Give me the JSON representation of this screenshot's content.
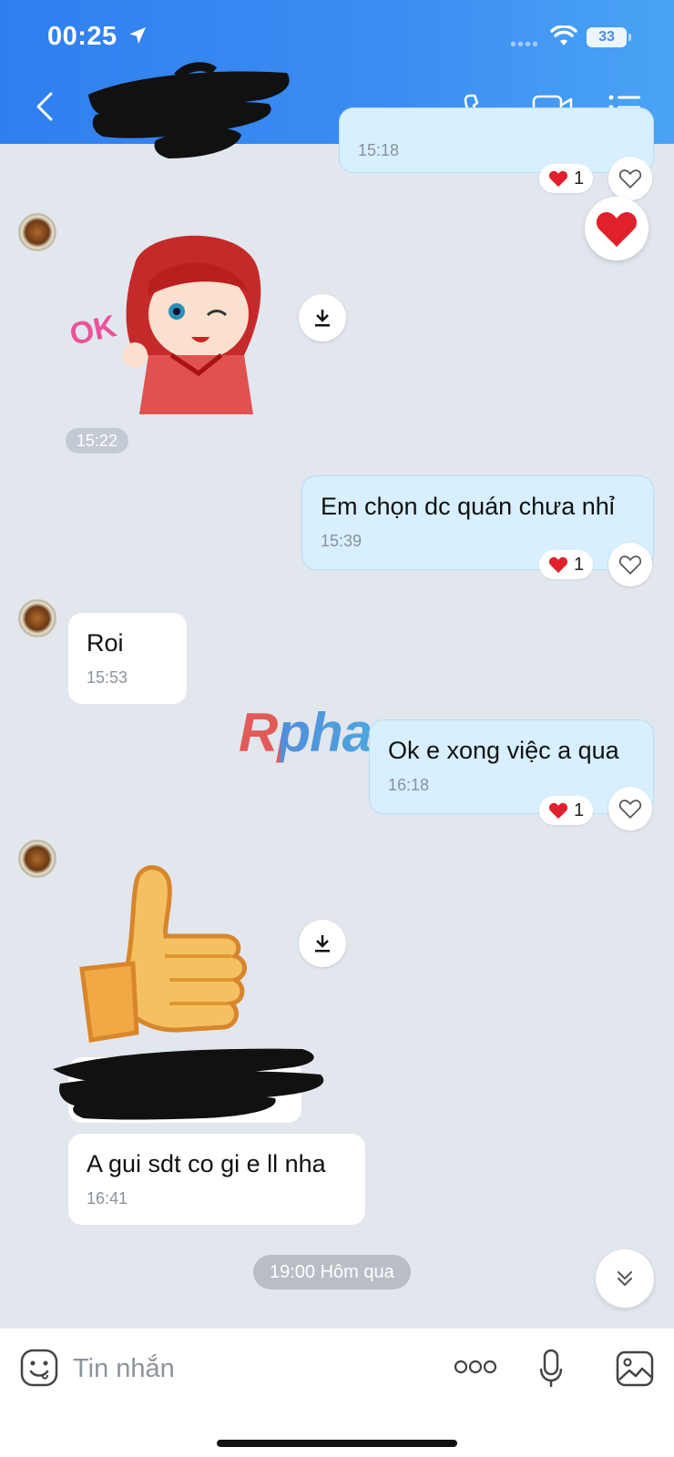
{
  "status_bar": {
    "time": "00:25",
    "battery": "33",
    "signal": "••••"
  },
  "header": {
    "contact_name": ""
  },
  "messages": [
    {
      "id": "m0",
      "direction": "out",
      "text": "",
      "time": "15:18",
      "reaction_count": "1"
    },
    {
      "id": "m1",
      "direction": "in",
      "type": "sticker",
      "sticker_name": "red-hood-girl-ok",
      "sticker_text": "OK",
      "time": "15:22"
    },
    {
      "id": "m2",
      "direction": "out",
      "text": "Em chọn dc quán chưa nhỉ",
      "time": "15:39",
      "reaction_count": "1"
    },
    {
      "id": "m3",
      "direction": "in",
      "text": "Roi",
      "time": "15:53"
    },
    {
      "id": "m4",
      "direction": "out",
      "text": "Ok e xong việc a qua",
      "time": "16:18",
      "reaction_count": "1"
    },
    {
      "id": "m5",
      "direction": "in",
      "type": "sticker",
      "sticker_name": "thumbs-up"
    },
    {
      "id": "m6",
      "direction": "in",
      "text": "A gui sdt co gi e ll nha",
      "time": "16:41"
    }
  ],
  "date_separator": "19:00 Hôm qua",
  "watermark": "Rphang",
  "input": {
    "placeholder": "Tin nhắn",
    "value": ""
  },
  "colors": {
    "header": "#3a8cf2",
    "outgoing_bubble": "#d7efff",
    "incoming_bubble": "#ffffff",
    "chat_bg": "#e2e7ee",
    "heart": "#e0202a"
  },
  "icons": [
    "location-arrow-icon",
    "wifi-icon",
    "back-icon",
    "phone-icon",
    "video-call-icon",
    "menu-list-icon",
    "heart-icon",
    "heart-outline-icon",
    "download-icon",
    "chevron-double-down-icon",
    "emoji-icon",
    "more-icon",
    "mic-icon",
    "image-icon"
  ]
}
